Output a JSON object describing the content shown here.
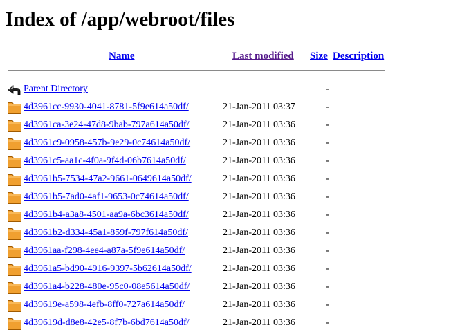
{
  "page_title": "Index of /app/webroot/files",
  "columns": {
    "name": "Name",
    "last_modified": "Last modified",
    "size": "Size",
    "description": "Description"
  },
  "parent": {
    "label": "Parent Directory",
    "size": "-",
    "icon": "back-arrow-icon"
  },
  "entries": [
    {
      "name": "4d3961cc-9930-4041-8781-5f9e614a50df/",
      "modified": "21-Jan-2011 03:37",
      "size": "-"
    },
    {
      "name": "4d3961ca-3e24-47d8-9bab-797a614a50df/",
      "modified": "21-Jan-2011 03:36",
      "size": "-"
    },
    {
      "name": "4d3961c9-0958-457b-9e29-0c74614a50df/",
      "modified": "21-Jan-2011 03:36",
      "size": "-"
    },
    {
      "name": "4d3961c5-aa1c-4f0a-9f4d-06b7614a50df/",
      "modified": "21-Jan-2011 03:36",
      "size": "-"
    },
    {
      "name": "4d3961b5-7534-47a2-9661-0649614a50df/",
      "modified": "21-Jan-2011 03:36",
      "size": "-"
    },
    {
      "name": "4d3961b5-7ad0-4af1-9653-0c74614a50df/",
      "modified": "21-Jan-2011 03:36",
      "size": "-"
    },
    {
      "name": "4d3961b4-a3a8-4501-aa9a-6bc3614a50df/",
      "modified": "21-Jan-2011 03:36",
      "size": "-"
    },
    {
      "name": "4d3961b2-d334-45a1-859f-797f614a50df/",
      "modified": "21-Jan-2011 03:36",
      "size": "-"
    },
    {
      "name": "4d3961aa-f298-4ee4-a87a-5f9e614a50df/",
      "modified": "21-Jan-2011 03:36",
      "size": "-"
    },
    {
      "name": "4d3961a5-bd90-4916-9397-5b62614a50df/",
      "modified": "21-Jan-2011 03:36",
      "size": "-"
    },
    {
      "name": "4d3961a4-b228-480e-95c0-08e5614a50df/",
      "modified": "21-Jan-2011 03:36",
      "size": "-"
    },
    {
      "name": "4d39619e-a598-4efb-8ff0-727a614a50df/",
      "modified": "21-Jan-2011 03:36",
      "size": "-"
    },
    {
      "name": "4d39619d-d8e8-42e5-8f7b-6bd7614a50df/",
      "modified": "21-Jan-2011 03:36",
      "size": "-"
    }
  ],
  "entry_icon": "folder-icon",
  "colors": {
    "link": "#0000ee",
    "visited_link": "#551a8b",
    "folder_fill": "#f0a030",
    "folder_stroke": "#a05a00"
  }
}
